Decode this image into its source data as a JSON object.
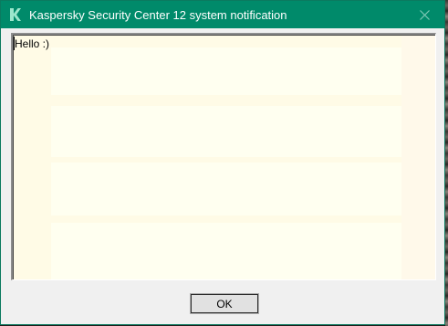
{
  "window": {
    "title": "Kaspersky Security Center 12 system notification",
    "app_icon": "kaspersky-k-icon",
    "close_icon": "close-icon",
    "accent_color": "#008a6a"
  },
  "message": {
    "text": "Hello :)"
  },
  "actions": {
    "ok_label": "OK"
  }
}
